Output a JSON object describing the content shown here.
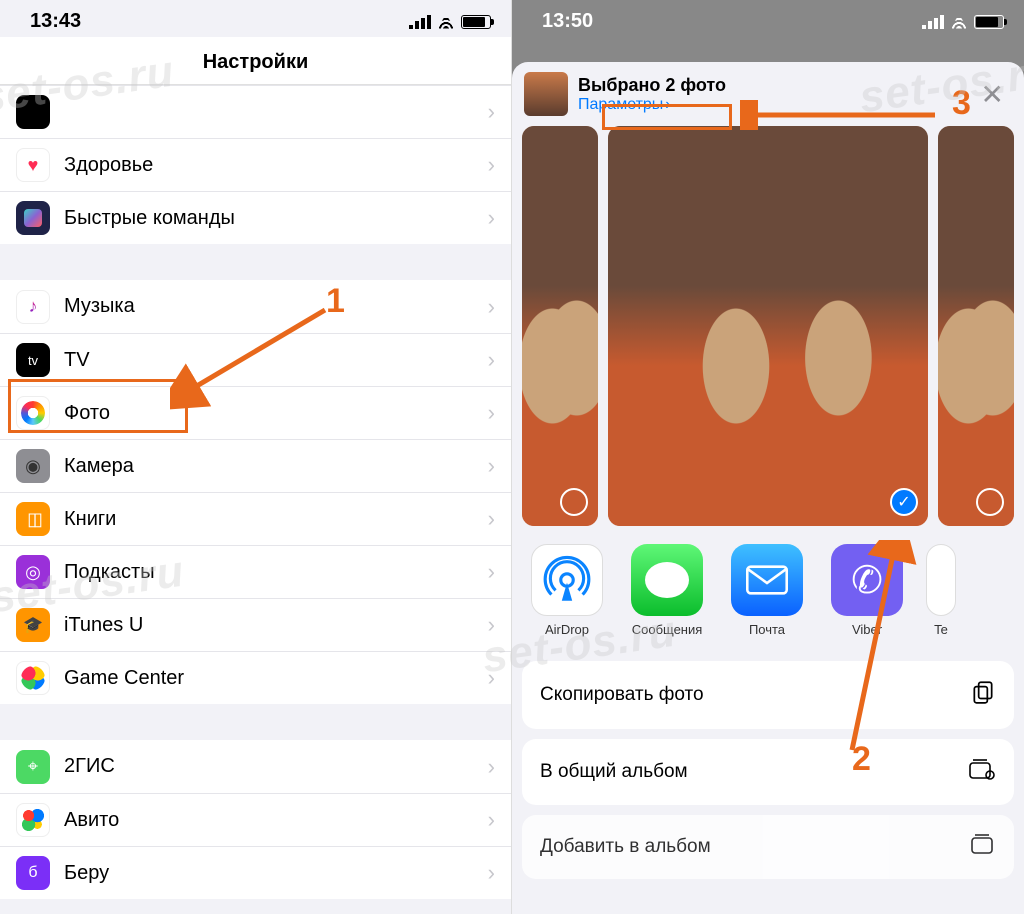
{
  "left": {
    "time": "13:43",
    "title": "Настройки",
    "groups": [
      {
        "items": [
          {
            "icon": "health",
            "label": "Здоровье"
          },
          {
            "icon": "short",
            "label": "Быстрые команды"
          }
        ]
      },
      {
        "items": [
          {
            "icon": "music",
            "label": "Музыка"
          },
          {
            "icon": "tv",
            "label": "TV"
          },
          {
            "icon": "photo",
            "label": "Фото"
          },
          {
            "icon": "camera",
            "label": "Камера"
          },
          {
            "icon": "books",
            "label": "Книги"
          },
          {
            "icon": "podcast",
            "label": "Подкасты"
          },
          {
            "icon": "itunes",
            "label": "iTunes U"
          },
          {
            "icon": "gc",
            "label": "Game Center"
          }
        ]
      },
      {
        "items": [
          {
            "icon": "2gis",
            "label": "2ГИС"
          },
          {
            "icon": "avito",
            "label": "Авито"
          },
          {
            "icon": "beru",
            "label": "Беру"
          }
        ]
      }
    ],
    "annotations": {
      "step1": "1"
    }
  },
  "right": {
    "time": "13:50",
    "selected_title": "Выбрано 2 фото",
    "options_label": "Параметры",
    "share_apps": [
      {
        "label": "AirDrop",
        "kind": "air"
      },
      {
        "label": "Сообщения",
        "kind": "msg"
      },
      {
        "label": "Почта",
        "kind": "mail"
      },
      {
        "label": "Viber",
        "kind": "viber"
      },
      {
        "label": "Te",
        "kind": "te"
      }
    ],
    "actions": [
      {
        "label": "Скопировать фото",
        "icon": "copy"
      },
      {
        "label": "В общий альбом",
        "icon": "shared"
      },
      {
        "label": "Добавить в альбом",
        "icon": "add"
      }
    ],
    "annotations": {
      "step2": "2",
      "step3": "3"
    }
  },
  "watermark": "set-os.ru"
}
